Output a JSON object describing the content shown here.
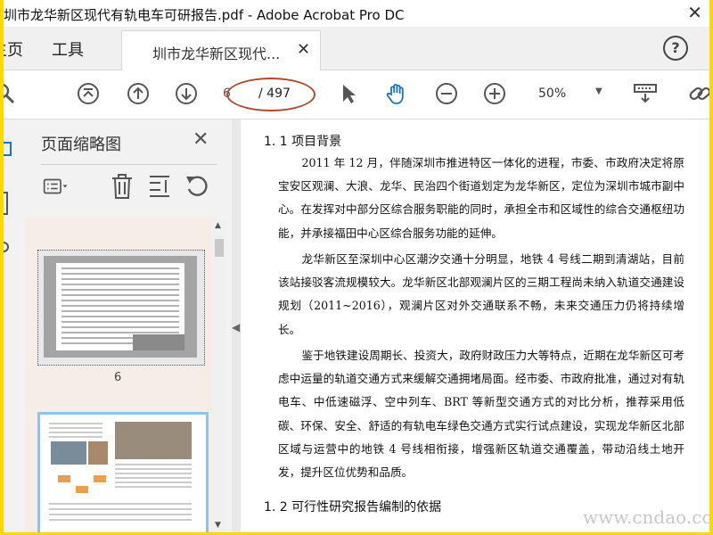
{
  "window": {
    "title": "圳市龙华新区现代有轨电车可研报告.pdf - Adobe Acrobat Pro DC",
    "close_glyph": "✕"
  },
  "nav": {
    "home_label": "主页",
    "tools_label": "工具",
    "doc_tab_label": "圳市龙华新区现代...",
    "doc_tab_close": "✕",
    "help_glyph": "?"
  },
  "toolbar": {
    "current_page": "6",
    "total_pages": "/ 497",
    "zoom_value": "50%",
    "icons": [
      "search-icon",
      "scroll-up-icon",
      "prev-page-icon",
      "next-page-icon",
      "select-arrow-icon",
      "hand-icon",
      "zoom-out-icon",
      "zoom-in-icon",
      "keyboard-download-icon",
      "link-icon"
    ]
  },
  "thumbnails_panel": {
    "title": "页面缩略图",
    "close_glyph": "✕",
    "tools": [
      "thumb-options-icon",
      "delete-page-icon",
      "crop-page-icon",
      "rotate-page-icon"
    ],
    "pages": [
      {
        "number": "6"
      }
    ]
  },
  "document": {
    "heading_1": "1. 1 项目背景",
    "para_1_lines": [
      "2011 年 12 月，伴随深圳市推进特区一体化的进程，市委、市政府决定将",
      "原宝安区观澜、大浪、龙华、民治四个街道划定为龙华新区，定位为深圳市城",
      "市副中心。在发挥对中部分区综合服务职能的同时，承担全市和区域性的综合",
      "交通枢纽功能，并承接福田中心区综合服务功能的延伸。"
    ],
    "para_2_lines": [
      "龙华新区至深圳中心区潮汐交通十分明显，地铁 4 号线二期到清湖站，目",
      "前该站接驳客流规模较大。龙华新区北部观澜片区的三期工程尚未纳入轨道交",
      "通建设规划（2011~2016），观澜片区对外交通联系不畅，未来交通压力仍将持",
      "续增长。"
    ],
    "para_3_lines": [
      "鉴于地铁建设周期长、投资大，政府财政压力大等特点，近期在龙华新区",
      "可考虑中运量的轨道交通方式来缓解交通拥堵局面。经市委、市政府批准，通",
      "过对有轨电车、中低速磁浮、空中列车、BRT 等新型交通方式的对比分析，推",
      "荐采用低碳、环保、安全、舒适的有轨电车绿色交通方式实行试点建设，实现",
      "龙华新区北部区域与运营中的地铁 4 号线相衔接，增强新区轨道交通覆盖，带",
      "动沿线土地开发，提升区位优势和品质。"
    ],
    "heading_2": "1. 2 可行性研究报告编制的依据"
  },
  "watermark": "www.cndao.com",
  "colors": {
    "outer_border": "#ffd800",
    "annotation_oval": "#b04a2e",
    "hand_tool_active": "#1a73c9",
    "thumb_selected_border": "#8ec3ec"
  }
}
